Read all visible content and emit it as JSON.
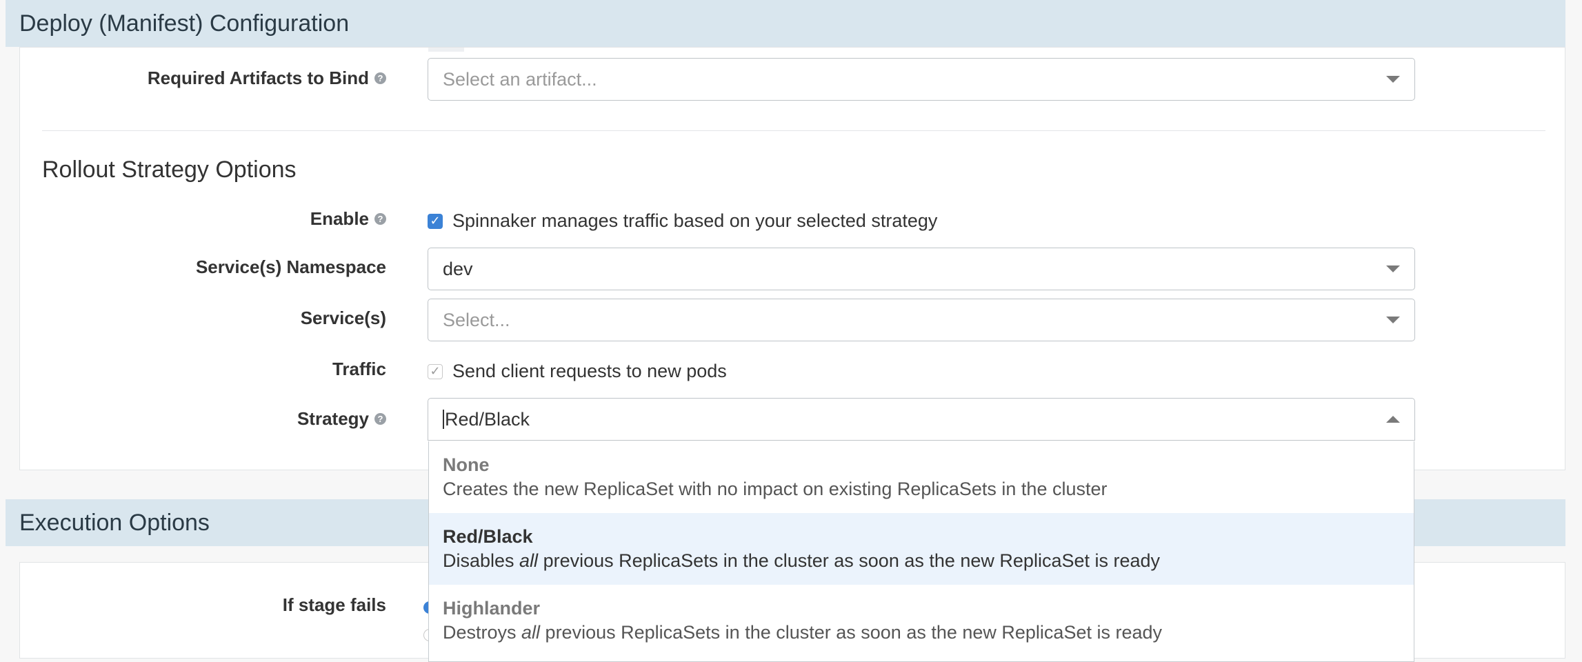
{
  "header": {
    "deploy_title": "Deploy (Manifest) Configuration",
    "execution_title": "Execution Options"
  },
  "artifacts": {
    "label": "Required Artifacts to Bind",
    "placeholder": "Select an artifact..."
  },
  "rollout": {
    "title": "Rollout Strategy Options",
    "enable": {
      "label": "Enable",
      "text": "Spinnaker manages traffic based on your selected strategy",
      "checked": true
    },
    "namespace": {
      "label": "Service(s) Namespace",
      "value": "dev"
    },
    "services": {
      "label": "Service(s)",
      "placeholder": "Select..."
    },
    "traffic": {
      "label": "Traffic",
      "text": "Send client requests to new pods"
    },
    "strategy": {
      "label": "Strategy",
      "value": "Red/Black",
      "options": [
        {
          "title": "None",
          "pre": "Creates the new ReplicaSet with no impact on existing ReplicaSets in the cluster",
          "em": "",
          "post": ""
        },
        {
          "title": "Red/Black",
          "pre": "Disables ",
          "em": "all",
          "post": " previous ReplicaSets in the cluster as soon as the new ReplicaSet is ready"
        },
        {
          "title": "Highlander",
          "pre": "Destroys ",
          "em": "all",
          "post": " previous ReplicaSets in the cluster as soon as the new ReplicaSet is ready"
        }
      ]
    }
  },
  "execution": {
    "if_fails_label": "If stage fails"
  },
  "icons": {
    "help": "?",
    "check": "✓"
  }
}
